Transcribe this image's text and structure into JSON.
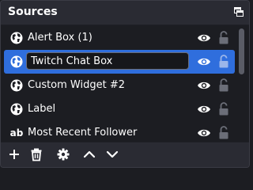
{
  "panel": {
    "title": "Sources",
    "float_icon": "undock-icon"
  },
  "colors": {
    "panel_bg": "#2a2b33",
    "list_bg": "#1c1d22",
    "selection": "#2f6edd",
    "icon": "#ffffff"
  },
  "sources": [
    {
      "label": "Alert Box (1)",
      "icon": "globe-icon",
      "visible": true,
      "locked": false,
      "selected": false,
      "editing": false
    },
    {
      "label": "Twitch Chat Box",
      "icon": "globe-icon",
      "visible": true,
      "locked": false,
      "selected": true,
      "editing": true
    },
    {
      "label": "Custom Widget #2",
      "icon": "globe-icon",
      "visible": true,
      "locked": false,
      "selected": false,
      "editing": false
    },
    {
      "label": "Label",
      "icon": "globe-icon",
      "visible": true,
      "locked": false,
      "selected": false,
      "editing": false
    },
    {
      "label": "Most Recent Follower",
      "icon": "text-icon",
      "icon_text": "ab",
      "visible": true,
      "locked": false,
      "selected": false,
      "editing": false
    }
  ],
  "toolbar": {
    "buttons": [
      "add-icon",
      "trash-icon",
      "gear-icon",
      "chevron-up-icon",
      "chevron-down-icon"
    ]
  }
}
